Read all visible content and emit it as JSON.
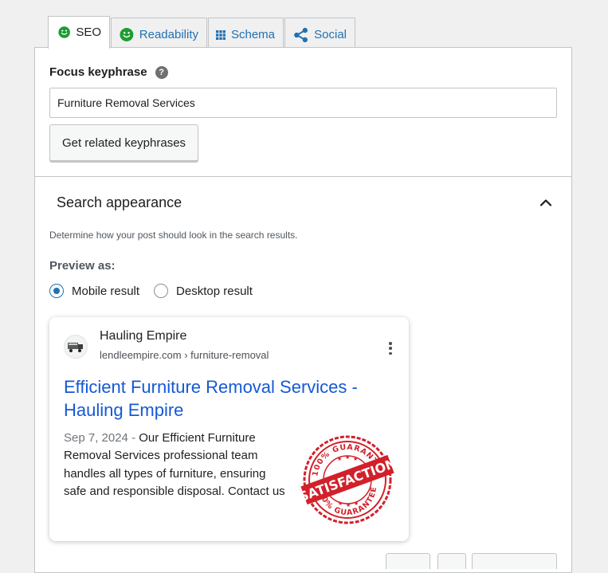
{
  "tabs": [
    {
      "label": "SEO",
      "icon": "smiley-icon",
      "active": true
    },
    {
      "label": "Readability",
      "icon": "smiley-icon",
      "active": false
    },
    {
      "label": "Schema",
      "icon": "grid-icon",
      "active": false
    },
    {
      "label": "Social",
      "icon": "share-icon",
      "active": false
    }
  ],
  "colors": {
    "accent": "#2271b1",
    "good": "#1c9d34",
    "serp_link": "#1558d6",
    "seal_red": "#d2202a"
  },
  "focus": {
    "label": "Focus keyphrase",
    "help": "?",
    "value": "Furniture Removal Services",
    "related_button": "Get related keyphrases"
  },
  "appearance": {
    "title": "Search appearance",
    "description": "Determine how your post should look in the search results.",
    "preview_label": "Preview as:",
    "options": [
      {
        "label": "Mobile result",
        "checked": true
      },
      {
        "label": "Desktop result",
        "checked": false
      }
    ]
  },
  "serp": {
    "site_name": "Hauling Empire",
    "url": "lendleempire.com › furniture-removal",
    "title": "Efficient Furniture Removal Services - Hauling Empire",
    "date": "Sep 7, 2024",
    "separator": " - ",
    "description": "Our Efficient Furniture Removal Services professional team handles all types of furniture, ensuring safe and responsible disposal. Contact us",
    "image_text": {
      "main": "SATISFACTION",
      "top": "100% GUARANTEE",
      "bottom": "100% GUARANTEE"
    }
  }
}
